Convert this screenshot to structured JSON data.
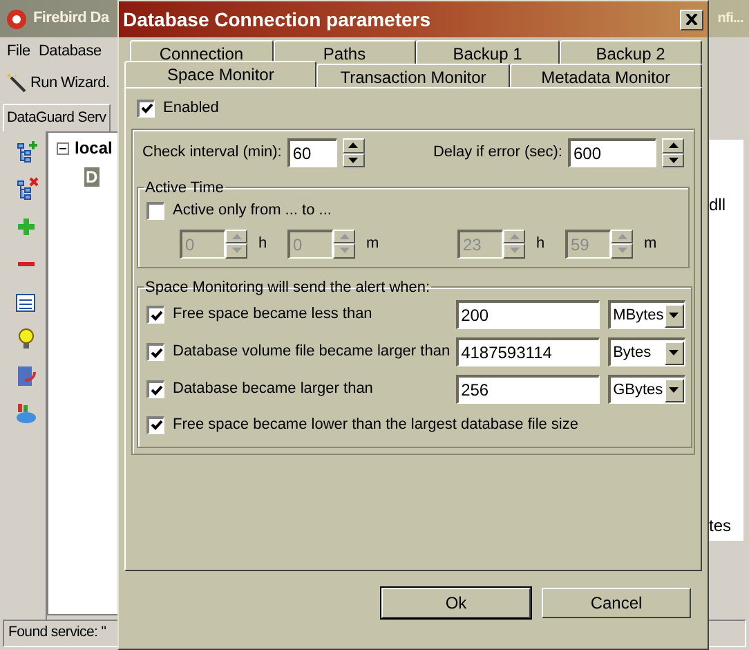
{
  "main_window": {
    "title": "Firebird Da",
    "title_tail": "nfi...",
    "menu": [
      "File",
      "Database"
    ],
    "toolbar_button": "Run Wizard.",
    "panel_tab": "DataGuard Serv",
    "tree": [
      {
        "label": "local",
        "expanded": true,
        "children": [
          {
            "label": "D",
            "selected": true
          }
        ]
      }
    ],
    "list_fragments": [
      "dll",
      "tes"
    ],
    "status": "Found service: \""
  },
  "dialog": {
    "title": "Database Connection parameters",
    "tab_rows": [
      {
        "tabs": [
          {
            "label": "Connection",
            "selected": false
          },
          {
            "label": "Paths",
            "selected": false
          },
          {
            "label": "Backup 1",
            "selected": false
          },
          {
            "label": "Backup 2",
            "selected": false
          }
        ]
      },
      {
        "tabs": [
          {
            "label": "Space Monitor",
            "selected": true
          },
          {
            "label": "Transaction Monitor",
            "selected": false
          },
          {
            "label": "Metadata Monitor",
            "selected": false
          }
        ]
      }
    ],
    "enabled": {
      "label": "Enabled",
      "checked": true
    },
    "check_interval": {
      "label": "Check interval (min):",
      "value": "60"
    },
    "delay": {
      "label": "Delay if error (sec):",
      "value": "600"
    },
    "active_time": {
      "title": "Active Time",
      "checkbox": {
        "label": "Active only from ... to ...",
        "checked": false
      },
      "fields": [
        {
          "value": "0",
          "unit": "h",
          "disabled": true
        },
        {
          "value": "0",
          "unit": "m",
          "disabled": true
        },
        {
          "value": "23",
          "unit": "h",
          "disabled": true
        },
        {
          "value": "59",
          "unit": "m",
          "disabled": true
        }
      ]
    },
    "alerts": {
      "title": "Space Monitoring will send the alert when:",
      "rules": [
        {
          "kind": "amount",
          "label": "Free space became less than",
          "checked": true,
          "value": "200",
          "unit": "MBytes"
        },
        {
          "kind": "amount",
          "label": "Database volume file became larger than",
          "checked": true,
          "value": "4187593114",
          "unit": "Bytes"
        },
        {
          "kind": "amount",
          "label": "Database became larger than",
          "checked": true,
          "value": "256",
          "unit": "GBytes"
        },
        {
          "kind": "flag",
          "label": "Free space became lower than the largest database file size",
          "checked": true
        }
      ]
    },
    "buttons": [
      "Ok",
      "Cancel"
    ]
  }
}
